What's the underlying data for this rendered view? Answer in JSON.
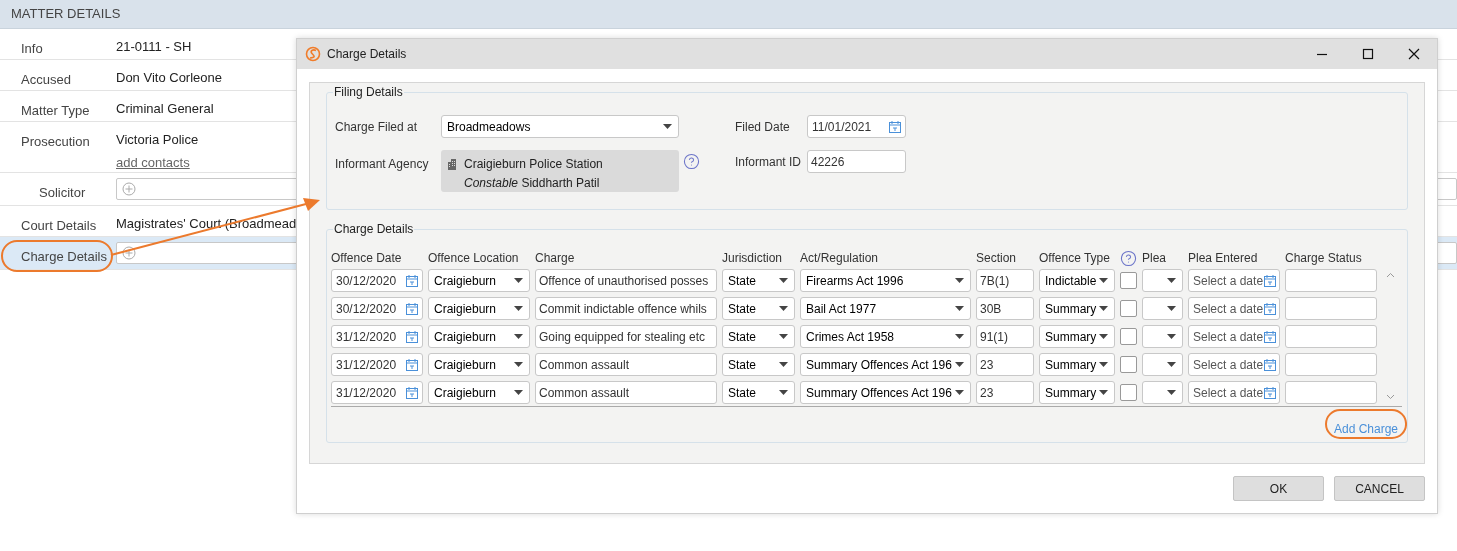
{
  "matter": {
    "title": "MATTER DETAILS",
    "rows": [
      {
        "kind": "text",
        "label": "Info",
        "value": "21-0111 - SH",
        "selected": false
      },
      {
        "kind": "text",
        "label": "Accused",
        "value": "Don Vito Corleone",
        "selected": false
      },
      {
        "kind": "text",
        "label": "Matter Type",
        "value": "Criminal General",
        "selected": false
      },
      {
        "kind": "text",
        "label": "Prosecution",
        "value": "Victoria Police",
        "link": "add contacts",
        "selected": false
      },
      {
        "kind": "add",
        "label": "Solicitor",
        "selected": false
      },
      {
        "kind": "text",
        "label": "Court Details",
        "value": "Magistrates' Court (Broadmead",
        "selected": false
      },
      {
        "kind": "add",
        "label": "Charge Details",
        "selected": true
      }
    ]
  },
  "dialog": {
    "title": "Charge Details",
    "filing": {
      "title": "Filing Details",
      "charge_filed_at": {
        "label": "Charge Filed at",
        "value": "Broadmeadows"
      },
      "filed_date": {
        "label": "Filed Date",
        "value": "11/01/2021"
      },
      "informant_agency": {
        "label": "Informant Agency",
        "station": "Craigieburn Police Station",
        "officer": "*Constable* Siddharth Patil"
      },
      "informant_id": {
        "label": "Informant ID",
        "value": "42226"
      }
    },
    "charges": {
      "title": "Charge Details",
      "columns": [
        {
          "kind": "text",
          "label": "Offence Date"
        },
        {
          "kind": "text",
          "label": "Offence Location"
        },
        {
          "kind": "text",
          "label": "Charge"
        },
        {
          "kind": "text",
          "label": "Jurisdiction"
        },
        {
          "kind": "text",
          "label": "Act/Regulation"
        },
        {
          "kind": "text",
          "label": "Section"
        },
        {
          "kind": "text",
          "label": "Offence Type"
        },
        {
          "kind": "help"
        },
        {
          "kind": "text",
          "label": "Plea"
        },
        {
          "kind": "text",
          "label": "Plea Entered"
        },
        {
          "kind": "text",
          "label": "Charge Status"
        }
      ],
      "rows": [
        {
          "date": "30/12/2020",
          "location": "Craigieburn",
          "charge": "Offence of unauthorised posses",
          "jurisdiction": "State",
          "act": "Firearms Act 1996",
          "section": "7B(1)",
          "offence_type": "Indictable",
          "checked": false,
          "plea_entered_placeholder": "Select a date"
        },
        {
          "date": "30/12/2020",
          "location": "Craigieburn",
          "charge": "Commit indictable offence whils",
          "jurisdiction": "State",
          "act": "Bail Act 1977",
          "section": "30B",
          "offence_type": "Summary",
          "checked": false,
          "plea_entered_placeholder": "Select a date"
        },
        {
          "date": "31/12/2020",
          "location": "Craigieburn",
          "charge": "Going equipped for stealing etc",
          "jurisdiction": "State",
          "act": "Crimes Act 1958",
          "section": "91(1)",
          "offence_type": "Summary",
          "checked": false,
          "plea_entered_placeholder": "Select a date"
        },
        {
          "date": "31/12/2020",
          "location": "Craigieburn",
          "charge": "Common assault",
          "jurisdiction": "State",
          "act": "Summary Offences Act 196",
          "section": "23",
          "offence_type": "Summary",
          "checked": false,
          "plea_entered_placeholder": "Select a date"
        },
        {
          "date": "31/12/2020",
          "location": "Craigieburn",
          "charge": "Common assault",
          "jurisdiction": "State",
          "act": "Summary Offences Act 196",
          "section": "23",
          "offence_type": "Summary",
          "checked": false,
          "plea_entered_placeholder": "Select a date"
        }
      ],
      "add_link": "Add Charge"
    },
    "buttons": [
      "OK",
      "CANCEL"
    ]
  }
}
